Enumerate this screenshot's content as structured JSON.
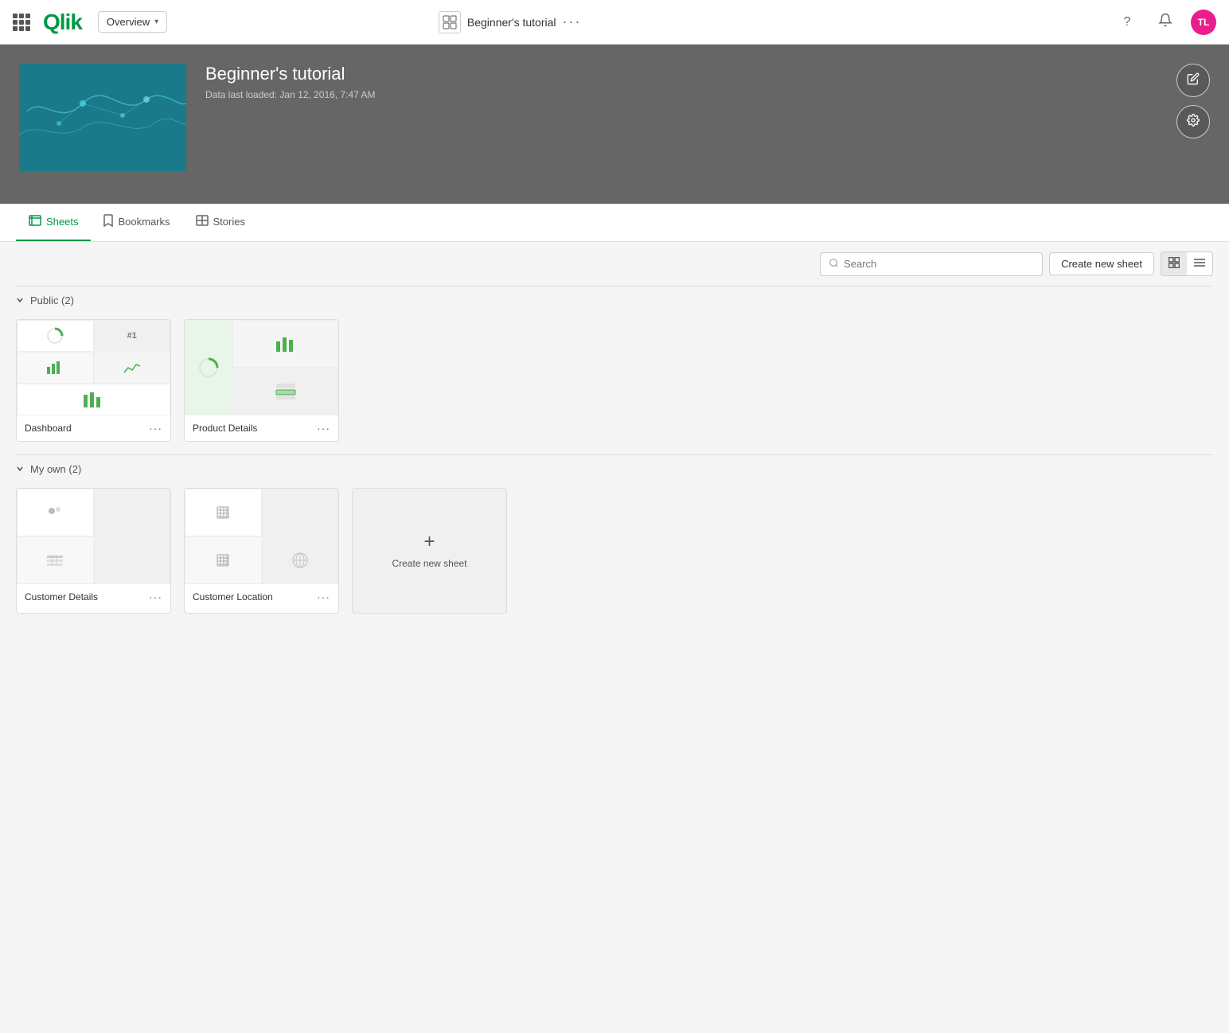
{
  "topnav": {
    "app_dropdown": "Overview",
    "app_dropdown_chevron": "▾",
    "app_title": "Beginner's tutorial",
    "app_more": "···",
    "help_icon": "?",
    "notification_icon": "🔔",
    "avatar_initials": "TL",
    "avatar_bg": "#e91e8c"
  },
  "hero": {
    "title": "Beginner's tutorial",
    "subtitle": "Data last loaded: Jan 12, 2016, 7:47 AM",
    "edit_icon": "✏",
    "settings_icon": "⚙"
  },
  "tabs": [
    {
      "id": "sheets",
      "label": "Sheets",
      "active": true
    },
    {
      "id": "bookmarks",
      "label": "Bookmarks",
      "active": false
    },
    {
      "id": "stories",
      "label": "Stories",
      "active": false
    }
  ],
  "toolbar": {
    "search_placeholder": "Search",
    "create_sheet_btn": "Create new sheet",
    "grid_view_icon": "⊞",
    "list_view_icon": "≡"
  },
  "sections": [
    {
      "id": "public",
      "label": "Public (2)",
      "expanded": true,
      "sheets": [
        {
          "id": "dashboard",
          "name": "Dashboard",
          "type": "dashboard"
        },
        {
          "id": "product-details",
          "name": "Product Details",
          "type": "product"
        }
      ]
    },
    {
      "id": "myown",
      "label": "My own (2)",
      "expanded": true,
      "sheets": [
        {
          "id": "customer-details",
          "name": "Customer Details",
          "type": "customer-details"
        },
        {
          "id": "customer-location",
          "name": "Customer Location",
          "type": "customer-location"
        }
      ],
      "has_create": true
    }
  ],
  "create_new_sheet": "Create new sheet"
}
